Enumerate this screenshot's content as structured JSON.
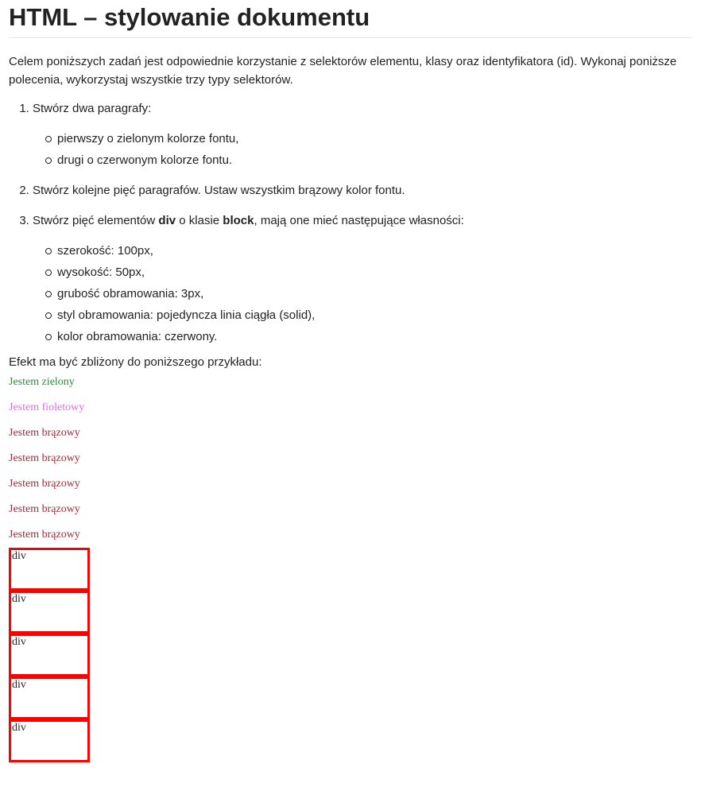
{
  "title": "HTML – stylowanie dokumentu",
  "intro": "Celem poniższych zadań jest odpowiednie korzystanie z selektorów elementu, klasy oraz identyfikatora (id). Wykonaj poniższe polecenia, wykorzystaj wszystkie trzy typy selektorów.",
  "tasks": {
    "t1": "Stwórz dwa paragrafy:",
    "t1_items": [
      "pierwszy o zielonym kolorze fontu,",
      "drugi o czerwonym kolorze fontu."
    ],
    "t2": "Stwórz kolejne pięć paragrafów. Ustaw wszystkim brązowy kolor fontu.",
    "t3_pre": "Stwórz pięć elementów ",
    "t3_div": "div",
    "t3_mid": " o klasie ",
    "t3_block": "block",
    "t3_post": ", mają one mieć następujące własności:",
    "t3_items": [
      "szerokość: 100px,",
      "wysokość: 50px,",
      "grubość obramowania: 3px,",
      "styl obramowania: pojedyncza linia ciągła (solid),",
      "kolor obramowania: czerwony."
    ]
  },
  "effect_label": "Efekt ma być zbliżony do poniższego przykładu:",
  "examples": {
    "green": "Jestem zielony",
    "violet": "Jestem fioletowy",
    "brown": [
      "Jestem brązowy",
      "Jestem brązowy",
      "Jestem brązowy",
      "Jestem brązowy",
      "Jestem brązowy"
    ],
    "blocks": [
      "div",
      "div",
      "div",
      "div",
      "div"
    ]
  },
  "colors": {
    "green": "#2e8b3d",
    "violet": "#ee66ee",
    "brown": "#a3293c",
    "block_border": "#ff0000"
  }
}
